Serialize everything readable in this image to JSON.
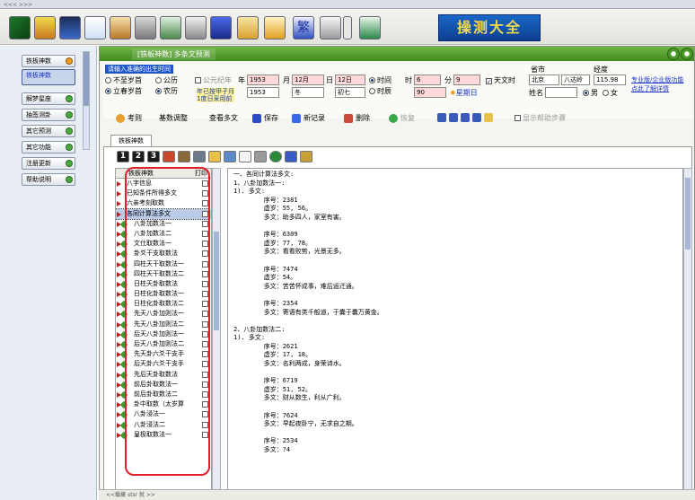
{
  "window": {
    "title": "<<< >>>"
  },
  "toolbar": {
    "banner": "操测大全"
  },
  "sidebar": {
    "items": [
      {
        "label": "铁板神数"
      },
      {
        "label": "铁板神数"
      },
      {
        "label": "解梦星座"
      },
      {
        "label": "抽签测卦"
      },
      {
        "label": "其它预测"
      },
      {
        "label": "其它功能"
      },
      {
        "label": "注册更新"
      },
      {
        "label": "帮助说明"
      }
    ]
  },
  "main": {
    "title": "[铁板神数] 多条文预测"
  },
  "form": {
    "prompt": "请输入准确的出生时间",
    "radio_uncertain": "不至岁首",
    "radio_gregorian": "公历",
    "radio_spring": "立春岁首",
    "radio_lunar": "农历",
    "calendar_label": "公元纪年",
    "year_label": "年",
    "month_label": "月",
    "day_label": "日",
    "hour_label": "时",
    "minute_label": "分",
    "year_value": "1953",
    "year_value2": "1953",
    "month_value": "12月",
    "month_value2": "冬",
    "day_value": "12日",
    "day_value2": "初七",
    "hour_value": "6",
    "minute_value": "9",
    "hour_mode_time": "时间",
    "hour_mode_period": "时辰",
    "period_value": "90",
    "weekday": "星期日",
    "note_line1": "年已按甲子月",
    "note_line2": "1度日采用前",
    "solar_time": "天文时",
    "province_label": "省市",
    "province_value": "北京",
    "city_value": "八达岭",
    "longitude_label": "经度",
    "longitude_value": "115.98",
    "name_label": "姓名",
    "gender_male": "男",
    "gender_female": "女",
    "link1": "专业版/企业版功能",
    "link2": "点此了解详情"
  },
  "actions": {
    "calc": "考则",
    "fine_tune": "基数调整",
    "view_multi": "查看多文",
    "save": "保存",
    "new_record": "新记录",
    "delete": "删除",
    "restore": "恢复",
    "show_aux": "显示帮助步骤"
  },
  "tab": {
    "label": "铁板神数"
  },
  "tree": {
    "col_name": "铁板神数",
    "col_print": "打印",
    "rows": [
      {
        "label": "八字信息",
        "type": "parent"
      },
      {
        "label": "已知条件所得多文",
        "type": "parent"
      },
      {
        "label": "六亲考刻取数",
        "type": "parent"
      },
      {
        "label": "各同计算法多文",
        "type": "parent",
        "selected": true
      },
      {
        "label": "八卦加数法一",
        "type": "child"
      },
      {
        "label": "八卦加数法二",
        "type": "child"
      },
      {
        "label": "文仕取数法一",
        "type": "child"
      },
      {
        "label": "卦爻干支取数法",
        "type": "child"
      },
      {
        "label": "四柱天干取数法一",
        "type": "child"
      },
      {
        "label": "四柱天干取数法二",
        "type": "child"
      },
      {
        "label": "日柱天卦取数法",
        "type": "child"
      },
      {
        "label": "日柱化卦取数法一",
        "type": "child"
      },
      {
        "label": "日柱化卦取数法二",
        "type": "child"
      },
      {
        "label": "先天八卦加则法一",
        "type": "child"
      },
      {
        "label": "先天八卦加则法二",
        "type": "child"
      },
      {
        "label": "后天八卦加则法一",
        "type": "child"
      },
      {
        "label": "后天八卦加则法二",
        "type": "child"
      },
      {
        "label": "先天卦六爻干支手",
        "type": "child"
      },
      {
        "label": "后天卦六爻干支手",
        "type": "child"
      },
      {
        "label": "先后天卦取数法",
        "type": "child"
      },
      {
        "label": "前后卦取数法一",
        "type": "child"
      },
      {
        "label": "前后卦取数法二",
        "type": "child"
      },
      {
        "label": "卦中取数（太岁算",
        "type": "child"
      },
      {
        "label": "八卦浸法一",
        "type": "child"
      },
      {
        "label": "八卦浸法二",
        "type": "child"
      },
      {
        "label": "皇极取数法一",
        "type": "child"
      }
    ]
  },
  "content": {
    "text": "一、各同计算法多文:\n1、八卦加数法一:\n1). 多文:\n        序号：2381\n        虚岁：55, 56。\n        多文：助多四人，家室有害。\n\n        序号：6309\n        虚岁：77, 78。\n        多文：看看败势，光景无多。\n\n        序号：7474\n        虚岁：54。\n        多文：苦苦怀成事，难后运迁通。\n\n        序号：2354\n        多文：寄语有类千般道，于囊于囊万黄金。\n\n2、八卦加数法二:\n1). 多文:\n        序号：2621\n        虚岁：17, 18。\n        多文：名利两成，身荣诗水。\n\n        序号：6719\n        虚岁：51, 52。\n        多文：财从数生，利从广利。\n\n        序号：7624\n        多文：早起夜卧宁，无求自之期。\n\n        序号：2534\n        多文：?4"
  },
  "status": {
    "text": "<<载藏 stsr 就 >>"
  }
}
